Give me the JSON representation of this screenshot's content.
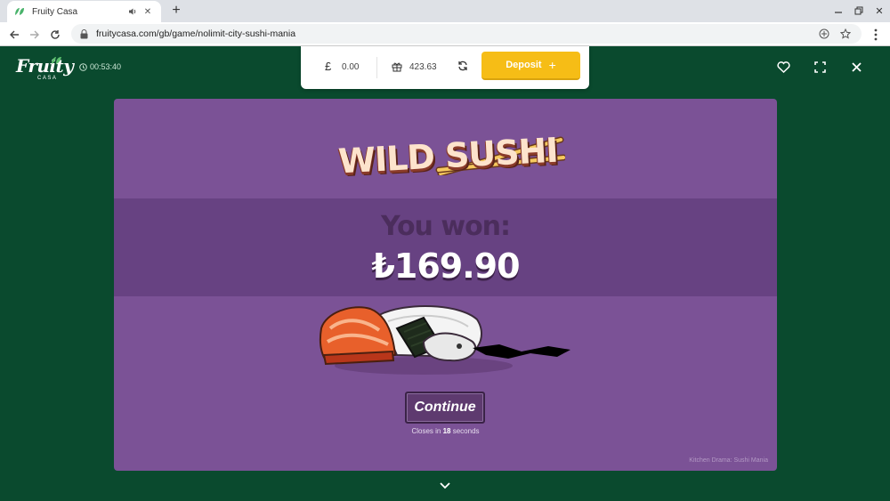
{
  "browser": {
    "tab_title": "Fruity Casa",
    "url": "fruitycasa.com/gb/game/nolimit-city-sushi-mania"
  },
  "site": {
    "logo_text": "Fruity",
    "logo_sub": "CASA",
    "session_time": "00:53:40",
    "wallet": {
      "currency_symbol": "£",
      "balance": "0.00",
      "bonus": "423.63",
      "deposit_label": "Deposit",
      "deposit_plus": "+"
    }
  },
  "game": {
    "title": "WILD SUSHI",
    "won_label": "You won:",
    "won_amount": "₺169.90",
    "continue_label": "Continue",
    "closes_prefix": "Closes in",
    "closes_seconds": "18",
    "closes_suffix": "seconds",
    "credit": "Kitchen Drama: Sushi Mania"
  },
  "colors": {
    "site_bg": "#0a4a2e",
    "game_bg": "#7b5296",
    "deposit": "#f6bd16"
  }
}
